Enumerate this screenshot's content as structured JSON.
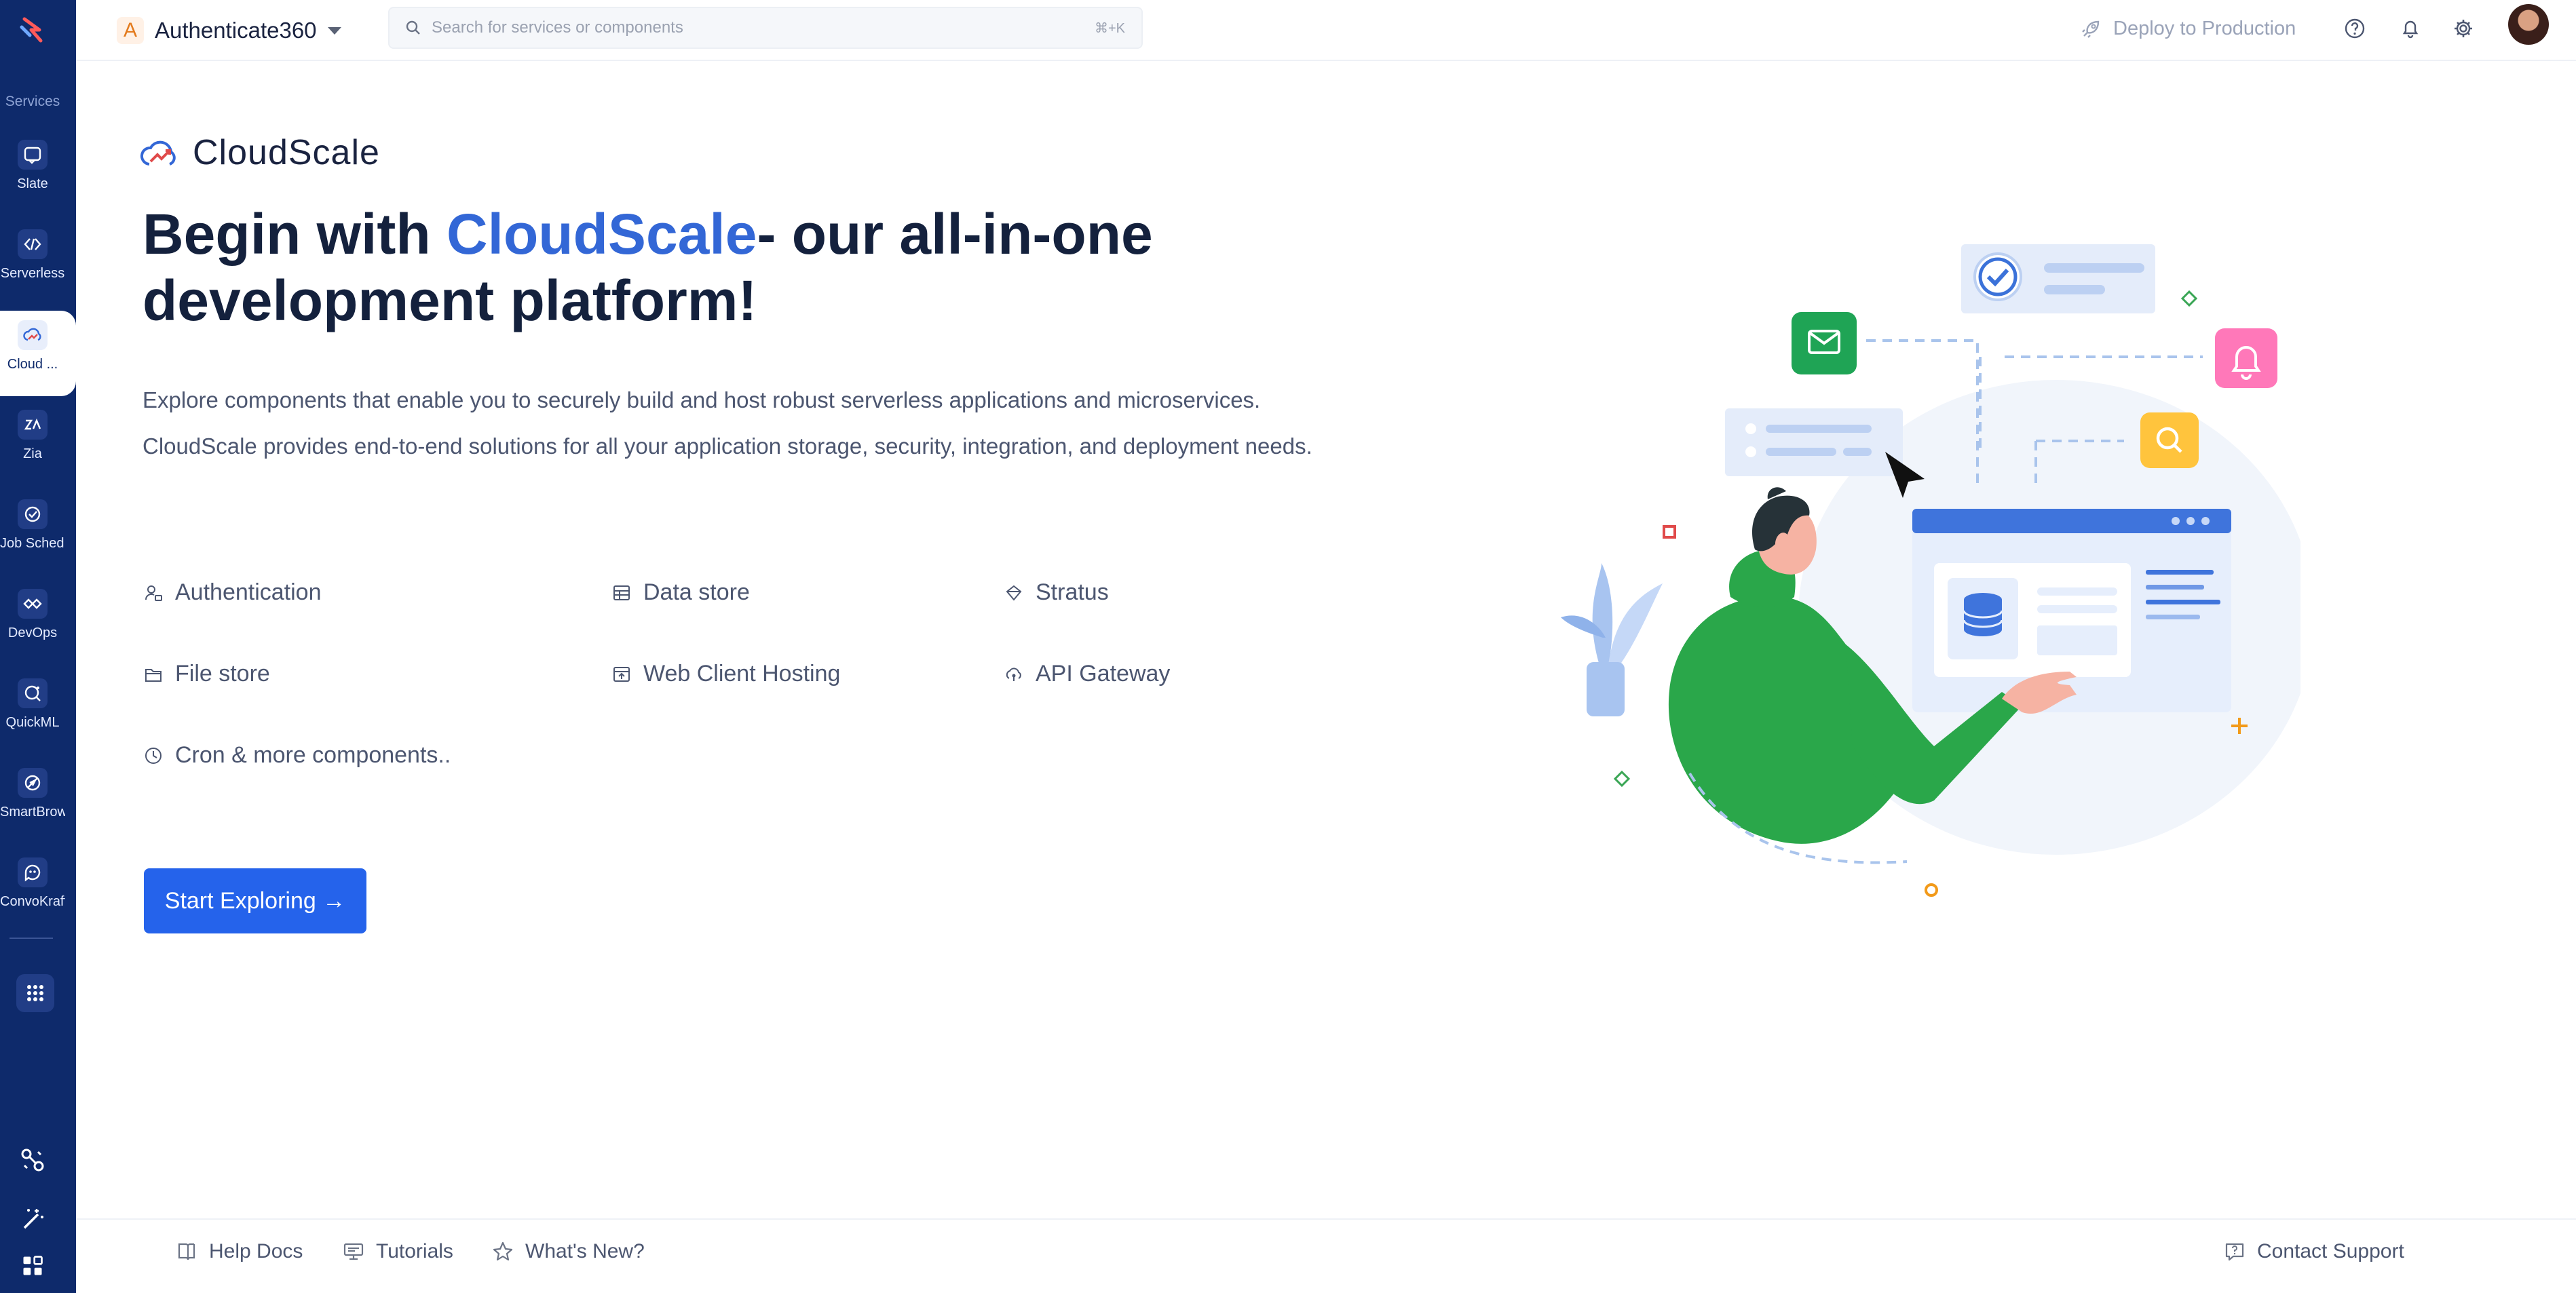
{
  "sidebar": {
    "section_label": "Services",
    "items": [
      {
        "label": "Slate",
        "icon": "slate-icon"
      },
      {
        "label": "Serverless",
        "icon": "serverless-icon"
      },
      {
        "label": "Cloud ...",
        "icon": "cloudscale-icon",
        "active": true
      },
      {
        "label": "Zia",
        "icon": "zia-icon"
      },
      {
        "label": "Job Sched...",
        "icon": "job-scheduling-icon"
      },
      {
        "label": "DevOps",
        "icon": "devops-icon"
      },
      {
        "label": "QuickML",
        "icon": "quickml-icon"
      },
      {
        "label": "SmartBrowz",
        "icon": "smartbrowz-icon"
      },
      {
        "label": "ConvoKraft",
        "icon": "convokraft-icon"
      }
    ],
    "bottom_icons": [
      "integrations-icon",
      "magic-wand-icon",
      "widgets-icon"
    ]
  },
  "topbar": {
    "project_initial": "A",
    "project_name": "Authenticate360",
    "search_placeholder": "Search for services or components",
    "search_shortcut": "⌘+K",
    "deploy_label": "Deploy to Production",
    "icons": [
      "help-icon",
      "bell-icon",
      "settings-icon"
    ]
  },
  "main": {
    "brand_name": "CloudScale",
    "headline_prefix": "Begin with ",
    "headline_brand": "CloudScale",
    "headline_suffix": "- our all-in-one development platform!",
    "intro": "Explore components that enable you to securely build and host robust serverless applications and microservices. CloudScale provides end-to-end solutions for all your application storage, security, integration, and deployment needs.",
    "features": [
      {
        "label": "Authentication",
        "icon": "user-lock-icon"
      },
      {
        "label": "Data store",
        "icon": "table-icon"
      },
      {
        "label": "Stratus",
        "icon": "stratus-icon"
      },
      {
        "label": "File store",
        "icon": "folder-icon"
      },
      {
        "label": "Web Client Hosting",
        "icon": "web-hosting-icon"
      },
      {
        "label": "API Gateway",
        "icon": "api-gateway-icon"
      },
      {
        "label": "Cron & more components..",
        "icon": "clock-icon"
      }
    ],
    "cta_label": "Start Exploring →"
  },
  "footer": {
    "help_docs": "Help Docs",
    "tutorials": "Tutorials",
    "whats_new": "What's New?",
    "contact_support": "Contact Support"
  },
  "colors": {
    "sidebar_bg": "#0e2a6b",
    "primary": "#2563eb",
    "highlight": "#f7c948",
    "brand_text": "#3367d6"
  }
}
